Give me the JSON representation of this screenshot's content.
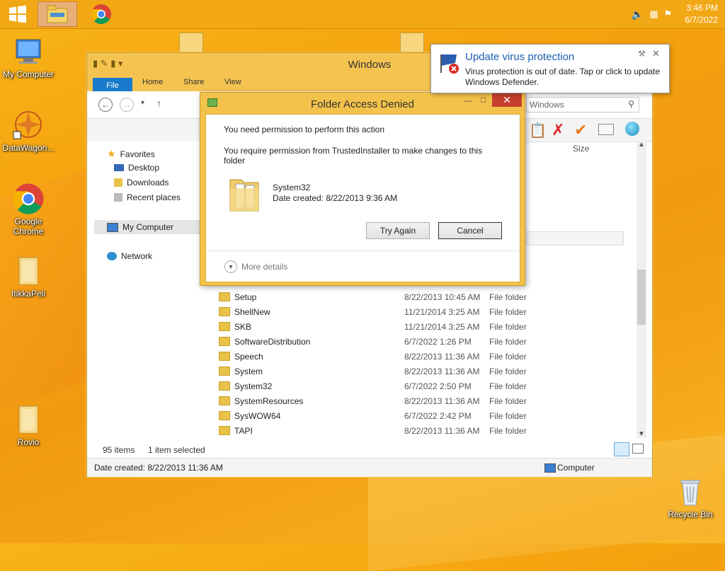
{
  "taskbar": {
    "time": "3:46 PM",
    "date": "6/7/2022"
  },
  "desktop": {
    "icons": [
      {
        "label": "My Computer"
      },
      {
        "label": "DataWagon..."
      },
      {
        "label": "Google Chrome"
      },
      {
        "label": "ItikkaPeli"
      },
      {
        "label": "Rovio"
      },
      {
        "label": "Recycle Bin"
      }
    ]
  },
  "explorer": {
    "title": "Windows",
    "tabs": [
      "File",
      "Home",
      "Share",
      "View"
    ],
    "search_placeholder": "Windows",
    "column_size": "Size",
    "nav": {
      "favorites": "Favorites",
      "desktop": "Desktop",
      "downloads": "Downloads",
      "recent": "Recent places",
      "computer": "My Computer",
      "network": "Network"
    },
    "rows": [
      {
        "name": "Setup",
        "date": "8/22/2013 10:45 AM",
        "type": "File folder"
      },
      {
        "name": "ShellNew",
        "date": "11/21/2014 3:25 AM",
        "type": "File folder"
      },
      {
        "name": "SKB",
        "date": "11/21/2014 3:25 AM",
        "type": "File folder"
      },
      {
        "name": "SoftwareDistribution",
        "date": "6/7/2022 1:26 PM",
        "type": "File folder"
      },
      {
        "name": "Speech",
        "date": "8/22/2013 11:36 AM",
        "type": "File folder"
      },
      {
        "name": "System",
        "date": "8/22/2013 11:36 AM",
        "type": "File folder"
      },
      {
        "name": "System32",
        "date": "6/7/2022 2:50 PM",
        "type": "File folder"
      },
      {
        "name": "SystemResources",
        "date": "8/22/2013 11:36 AM",
        "type": "File folder"
      },
      {
        "name": "SysWOW64",
        "date": "6/7/2022 2:42 PM",
        "type": "File folder"
      },
      {
        "name": "TAPI",
        "date": "8/22/2013 11:36 AM",
        "type": "File folder"
      }
    ],
    "status_items": "95 items",
    "status_selected": "1 item selected",
    "info_date": "Date created: 8/22/2013 11:36 AM",
    "info_location": "Computer"
  },
  "dialog": {
    "title": "Folder Access Denied",
    "heading": "You need permission to perform this action",
    "message": "You require permission from TrustedInstaller to make changes to this folder",
    "folder_name": "System32",
    "folder_date": "Date created: 8/22/2013 9:36 AM",
    "try_again": "Try Again",
    "cancel": "Cancel",
    "more_details": "More details"
  },
  "notification": {
    "title": "Update virus protection",
    "message": "Virus protection is out of date. Tap or click to update Windows Defender."
  }
}
